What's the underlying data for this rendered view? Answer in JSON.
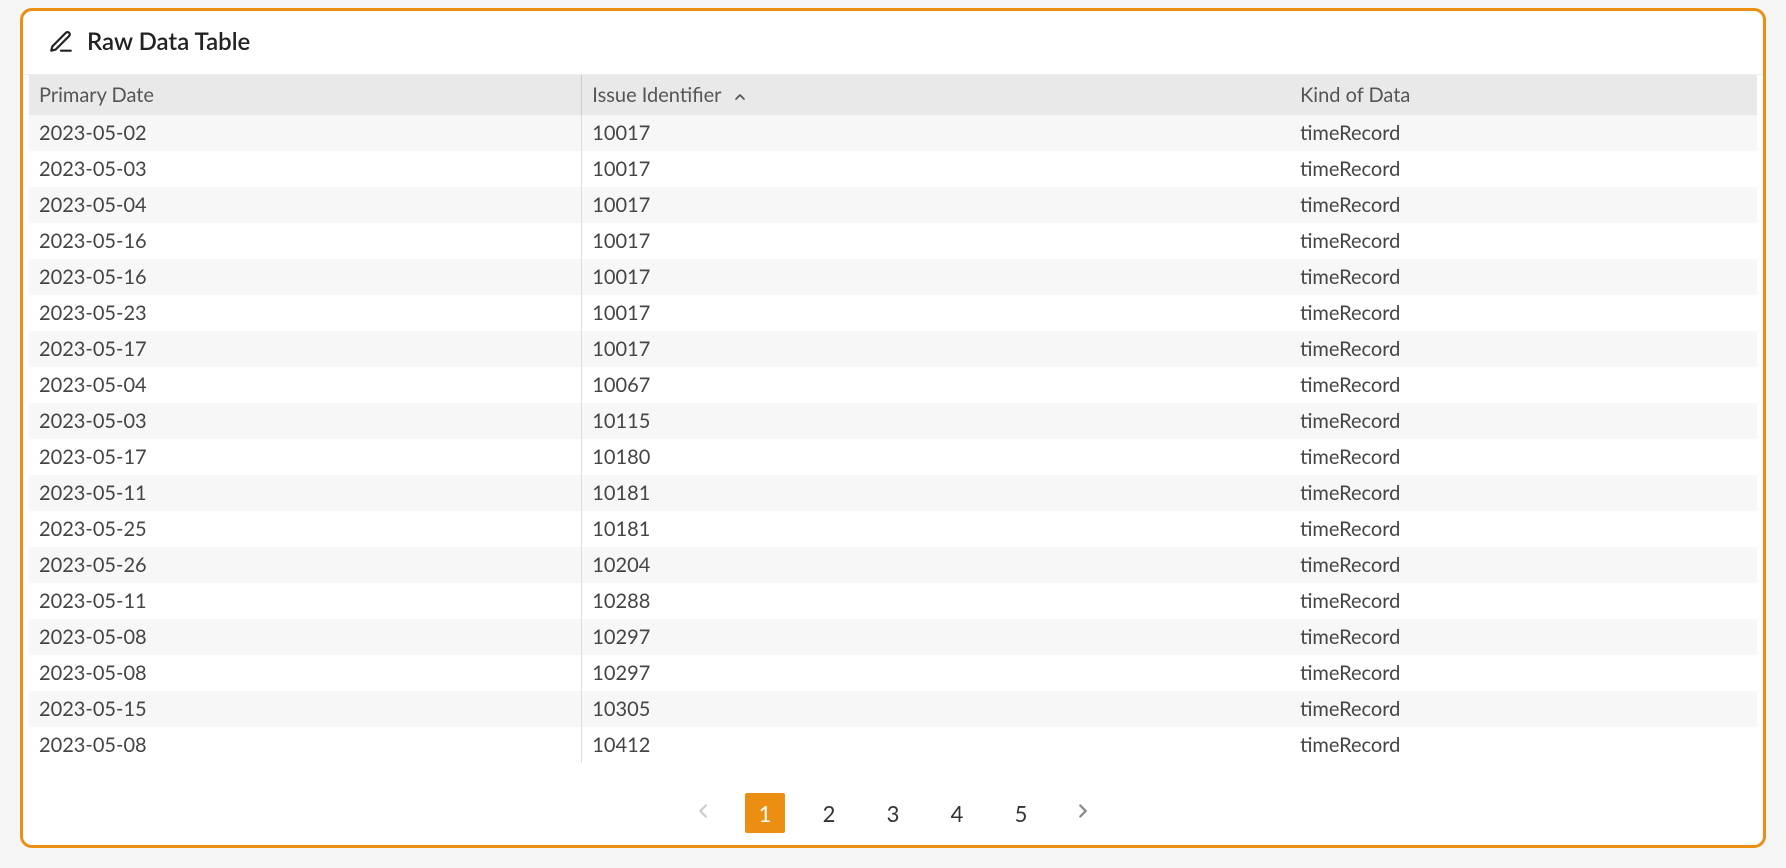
{
  "tab": {
    "title": "Raw Data Table"
  },
  "columns": [
    {
      "label": "Primary Date",
      "sortable": true,
      "sorted": false,
      "sortDir": null
    },
    {
      "label": "Issue Identifier",
      "sortable": true,
      "sorted": true,
      "sortDir": "asc"
    },
    {
      "label": "Kind of Data",
      "sortable": true,
      "sorted": false,
      "sortDir": null
    }
  ],
  "rows": [
    {
      "primaryDate": "2023-05-02",
      "issueIdentifier": "10017",
      "kindOfData": "timeRecord"
    },
    {
      "primaryDate": "2023-05-03",
      "issueIdentifier": "10017",
      "kindOfData": "timeRecord"
    },
    {
      "primaryDate": "2023-05-04",
      "issueIdentifier": "10017",
      "kindOfData": "timeRecord"
    },
    {
      "primaryDate": "2023-05-16",
      "issueIdentifier": "10017",
      "kindOfData": "timeRecord"
    },
    {
      "primaryDate": "2023-05-16",
      "issueIdentifier": "10017",
      "kindOfData": "timeRecord"
    },
    {
      "primaryDate": "2023-05-23",
      "issueIdentifier": "10017",
      "kindOfData": "timeRecord"
    },
    {
      "primaryDate": "2023-05-17",
      "issueIdentifier": "10017",
      "kindOfData": "timeRecord"
    },
    {
      "primaryDate": "2023-05-04",
      "issueIdentifier": "10067",
      "kindOfData": "timeRecord"
    },
    {
      "primaryDate": "2023-05-03",
      "issueIdentifier": "10115",
      "kindOfData": "timeRecord"
    },
    {
      "primaryDate": "2023-05-17",
      "issueIdentifier": "10180",
      "kindOfData": "timeRecord"
    },
    {
      "primaryDate": "2023-05-11",
      "issueIdentifier": "10181",
      "kindOfData": "timeRecord"
    },
    {
      "primaryDate": "2023-05-25",
      "issueIdentifier": "10181",
      "kindOfData": "timeRecord"
    },
    {
      "primaryDate": "2023-05-26",
      "issueIdentifier": "10204",
      "kindOfData": "timeRecord"
    },
    {
      "primaryDate": "2023-05-11",
      "issueIdentifier": "10288",
      "kindOfData": "timeRecord"
    },
    {
      "primaryDate": "2023-05-08",
      "issueIdentifier": "10297",
      "kindOfData": "timeRecord"
    },
    {
      "primaryDate": "2023-05-08",
      "issueIdentifier": "10297",
      "kindOfData": "timeRecord"
    },
    {
      "primaryDate": "2023-05-15",
      "issueIdentifier": "10305",
      "kindOfData": "timeRecord"
    },
    {
      "primaryDate": "2023-05-08",
      "issueIdentifier": "10412",
      "kindOfData": "timeRecord"
    }
  ],
  "pagination": {
    "pages": [
      "1",
      "2",
      "3",
      "4",
      "5"
    ],
    "current": "1",
    "prevEnabled": false,
    "nextEnabled": true
  },
  "colors": {
    "accent": "#ec8e11"
  }
}
